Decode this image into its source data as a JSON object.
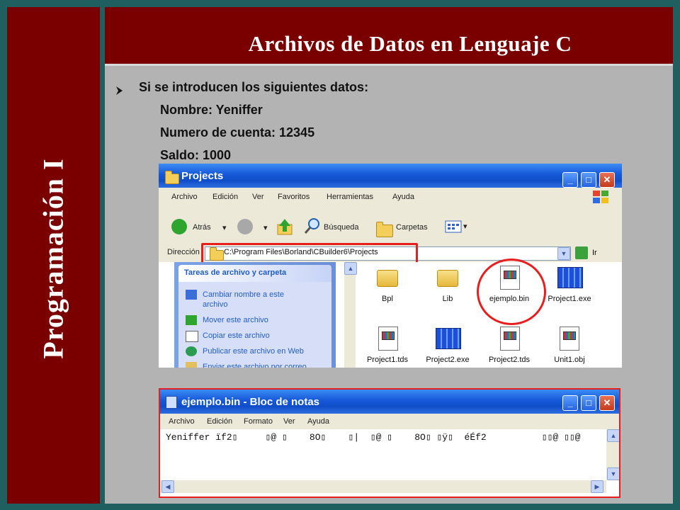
{
  "sidebar": {
    "title": "Programación I"
  },
  "slide": {
    "title": "Archivos de Datos en Lenguaje C",
    "lines": [
      "Si se introducen los siguientes datos:",
      "Nombre: Yeniffer",
      "Numero de cuenta: 12345",
      "Saldo: 1000"
    ]
  },
  "explorer": {
    "title": "Projects",
    "menu": [
      "Archivo",
      "Edición",
      "Ver",
      "Favoritos",
      "Herramientas",
      "Ayuda"
    ],
    "toolbar": {
      "back": "Atrás",
      "search": "Búsqueda",
      "folders": "Carpetas"
    },
    "address_label": "Dirección",
    "address_value": "C:\\Program Files\\Borland\\CBuilder6\\Projects",
    "go_label": "Ir",
    "task_header": "Tareas de archivo y carpeta",
    "tasks": [
      "Cambiar nombre a este",
      "archivo",
      "Mover este archivo",
      "Copiar este archivo",
      "Publicar este archivo en Web",
      "Enviar este archivo por correo"
    ],
    "files": [
      "Bpl",
      "Lib",
      "ejemplo.bin",
      "Project1.exe",
      "Project1.tds",
      "Project2.exe",
      "Project2.tds",
      "Unit1.obj"
    ]
  },
  "notepad": {
    "title": "ejemplo.bin - Bloc de notas",
    "menu": [
      "Archivo",
      "Edición",
      "Formato",
      "Ver",
      "Ayuda"
    ],
    "content": "Yeniffer ïf2▯     ▯@ ▯    8O▯    ▯|  ▯@ ▯    8O▯ ▯ÿ▯  éÉf2          ▯▯@ ▯▯@"
  },
  "colors": {
    "slide_red": "#7a0000",
    "xp_blue": "#1558d8",
    "highlight_red": "#e81e1e"
  }
}
